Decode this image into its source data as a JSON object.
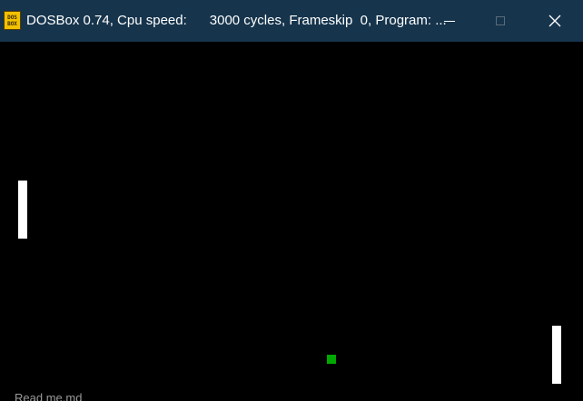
{
  "window": {
    "title": "DOSBox 0.74, Cpu speed:      3000 cycles, Frameskip  0, Program: ...",
    "icon": "dosbox-icon",
    "icon_text_top": "DOS",
    "icon_text_bottom": "BOX",
    "controls": {
      "minimize": "minimize-icon",
      "maximize": "maximize-icon",
      "close": "close-icon",
      "close_glyph": "✕"
    },
    "titlebar_color": "#16344c"
  },
  "game": {
    "type": "pong",
    "background_color": "#000000",
    "paddle_color": "#ffffff",
    "ball_color": "#00a800"
  },
  "background_peek_text": "Read me.md"
}
